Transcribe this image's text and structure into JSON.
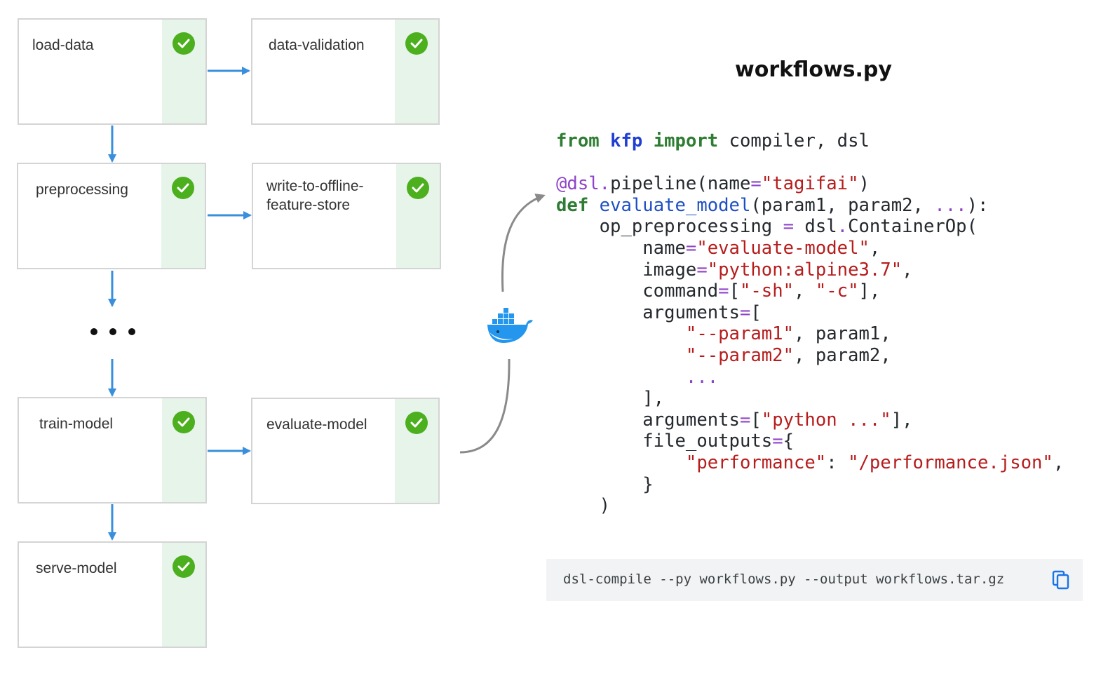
{
  "pipeline": {
    "nodes": [
      {
        "id": "load-data",
        "label": "load-data",
        "status": "succeeded"
      },
      {
        "id": "data-validation",
        "label": "data-validation",
        "status": "succeeded"
      },
      {
        "id": "preprocessing",
        "label": "preprocessing",
        "status": "succeeded"
      },
      {
        "id": "write-to-offline-feature-store",
        "label": "write-to-offline-\nfeature-store",
        "status": "succeeded"
      },
      {
        "id": "train-model",
        "label": "train-model",
        "status": "succeeded"
      },
      {
        "id": "evaluate-model",
        "label": "evaluate-model",
        "status": "succeeded"
      },
      {
        "id": "serve-model",
        "label": "serve-model",
        "status": "succeeded"
      }
    ],
    "edges": [
      [
        "load-data",
        "data-validation"
      ],
      [
        "load-data",
        "preprocessing"
      ],
      [
        "preprocessing",
        "write-to-offline-feature-store"
      ],
      [
        "preprocessing",
        "..."
      ],
      [
        "...",
        "train-model"
      ],
      [
        "train-model",
        "evaluate-model"
      ],
      [
        "train-model",
        "serve-model"
      ]
    ],
    "colors": {
      "edge": "#3a8fdc",
      "success": "#4caf1e",
      "status_strip": "#e6f4ea"
    }
  },
  "connector": {
    "icon": "docker-whale-icon"
  },
  "code_panel": {
    "filename": "workflows.py",
    "lines": [
      "from kfp import compiler, dsl",
      "",
      "@dsl.pipeline(name=\"tagifai\")",
      "def evaluate_model(param1, param2, ...):",
      "    op_preprocessing = dsl.ContainerOp(",
      "        name=\"evaluate-model\",",
      "        image=\"python:alpine3.7\",",
      "        command=[\"-sh\", \"-c\"],",
      "        arguments=[",
      "            \"--param1\", param1,",
      "            \"--param2\", param2,",
      "            ...",
      "        ],",
      "        arguments=[\"python ...\"],",
      "        file_outputs={",
      "            \"performance\": \"/performance.json\",",
      "        }",
      "    )"
    ]
  },
  "cli": {
    "command": "dsl-compile --py workflows.py --output workflows.tar.gz",
    "copy_icon": "copy-icon"
  }
}
